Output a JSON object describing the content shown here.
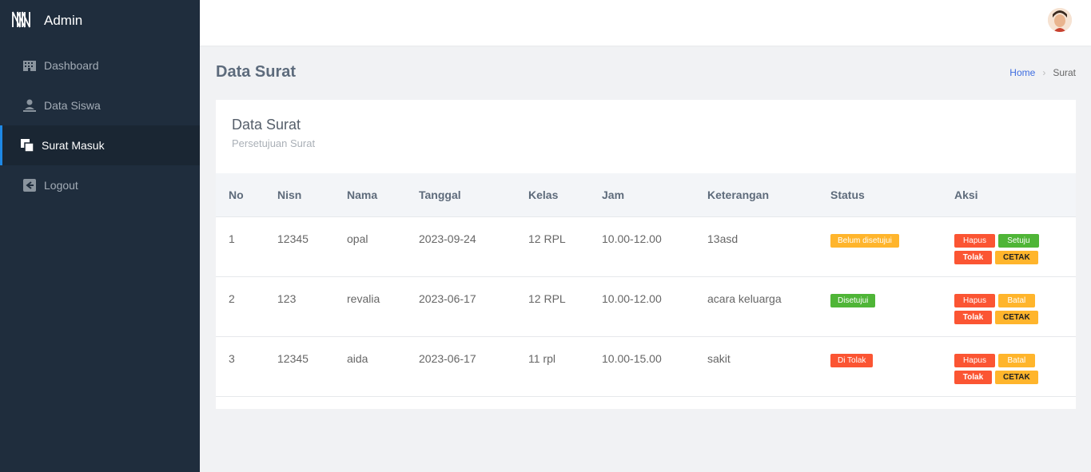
{
  "brand": {
    "title": "Admin"
  },
  "sidebar": {
    "items": [
      {
        "label": "Dashboard",
        "icon": "building-icon"
      },
      {
        "label": "Data Siswa",
        "icon": "user-icon"
      },
      {
        "label": "Surat Masuk",
        "icon": "copy-icon",
        "active": true
      },
      {
        "label": "Logout",
        "icon": "logout-icon"
      }
    ]
  },
  "header": {
    "title": "Data Surat"
  },
  "breadcrumb": {
    "home": "Home",
    "current": "Surat"
  },
  "card": {
    "title": "Data Surat",
    "subtitle": "Persetujuan Surat"
  },
  "table": {
    "columns": [
      "No",
      "Nisn",
      "Nama",
      "Tanggal",
      "Kelas",
      "Jam",
      "Keterangan",
      "Status",
      "Aksi"
    ],
    "rows": [
      {
        "no": "1",
        "nisn": "12345",
        "nama": "opal",
        "tanggal": "2023-09-24",
        "kelas": "12 RPL",
        "jam": "10.00-12.00",
        "keterangan": "13asd",
        "status": "Belum disetujui",
        "status_color": "#ffb52c",
        "actions": [
          "Hapus",
          "Setuju",
          "Tolak",
          "CETAK"
        ]
      },
      {
        "no": "2",
        "nisn": "123",
        "nama": "revalia",
        "tanggal": "2023-06-17",
        "kelas": "12 RPL",
        "jam": "10.00-12.00",
        "keterangan": "acara keluarga",
        "status": "Disetujui",
        "status_color": "#4fb537",
        "actions": [
          "Hapus",
          "Batal",
          "Tolak",
          "CETAK"
        ]
      },
      {
        "no": "3",
        "nisn": "12345",
        "nama": "aida",
        "tanggal": "2023-06-17",
        "kelas": "11 rpl",
        "jam": "10.00-15.00",
        "keterangan": "sakit",
        "status": "Di Tolak",
        "status_color": "#fb5533",
        "actions": [
          "Hapus",
          "Batal",
          "Tolak",
          "CETAK"
        ]
      }
    ]
  },
  "colors": {
    "sidebar": "#1f2d3d",
    "active_border": "#1e88e5",
    "link": "#3e6de0"
  }
}
